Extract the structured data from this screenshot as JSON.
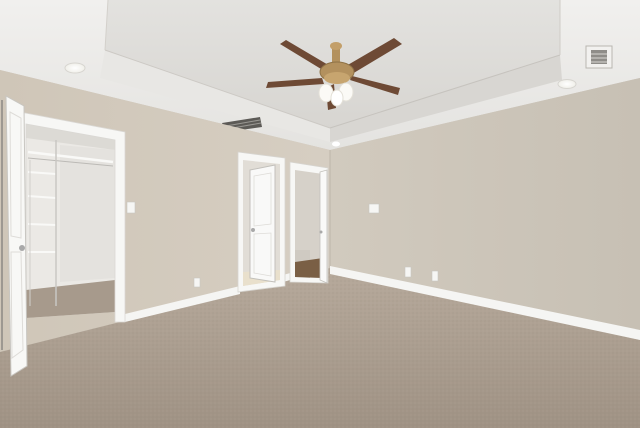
{
  "scene": {
    "subject": "empty-bedroom",
    "elements": [
      "tray-ceiling",
      "ceiling-fan",
      "recessed-lights",
      "hvac-vents",
      "walk-in-closet",
      "open-doors",
      "hallway",
      "carpet-floor",
      "baseboards",
      "outlets",
      "light-switches"
    ]
  },
  "colors": {
    "left_wall": "#d3cbbe",
    "right_wall": "#cdc6ba",
    "ceiling": "#e9e8e5",
    "tray": "#dcdad6",
    "trim": "#f7f7f5",
    "carpet": "#a99c8f",
    "fan_blade": "#6e4a35",
    "fan_metal": "#b3915e",
    "closet_interior": "#ebe9e5"
  }
}
